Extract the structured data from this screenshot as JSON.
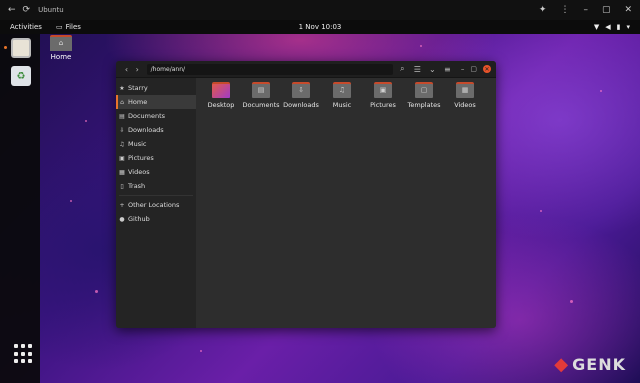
{
  "chrome": {
    "title": "Ubuntu"
  },
  "topbar": {
    "activities": "Activities",
    "app_menu": "Files",
    "clock": "1 Nov 10:03"
  },
  "desktop": {
    "home_label": "Home"
  },
  "window": {
    "path": "/home/ann/",
    "sidebar": [
      {
        "label": "Starry",
        "icon": "star-icon"
      },
      {
        "label": "Home",
        "icon": "home-icon",
        "active": true
      },
      {
        "label": "Documents",
        "icon": "document-icon"
      },
      {
        "label": "Downloads",
        "icon": "download-icon"
      },
      {
        "label": "Music",
        "icon": "music-icon"
      },
      {
        "label": "Pictures",
        "icon": "picture-icon"
      },
      {
        "label": "Videos",
        "icon": "video-icon"
      },
      {
        "label": "Trash",
        "icon": "trash-icon"
      },
      {
        "label": "Other Locations",
        "icon": "plus-icon"
      },
      {
        "label": "Github",
        "icon": "github-icon"
      }
    ],
    "folders": [
      {
        "label": "Desktop",
        "icon": "desktop-folder-icon"
      },
      {
        "label": "Documents",
        "icon": "documents-folder-icon"
      },
      {
        "label": "Downloads",
        "icon": "downloads-folder-icon"
      },
      {
        "label": "Music",
        "icon": "music-folder-icon"
      },
      {
        "label": "Pictures",
        "icon": "pictures-folder-icon"
      },
      {
        "label": "Templates",
        "icon": "templates-folder-icon"
      },
      {
        "label": "Videos",
        "icon": "videos-folder-icon"
      }
    ]
  },
  "watermark": {
    "text": "GENK"
  },
  "colors": {
    "accent": "#e8742a",
    "folder_tab": "#c64a2b",
    "close": "#e8532a"
  }
}
